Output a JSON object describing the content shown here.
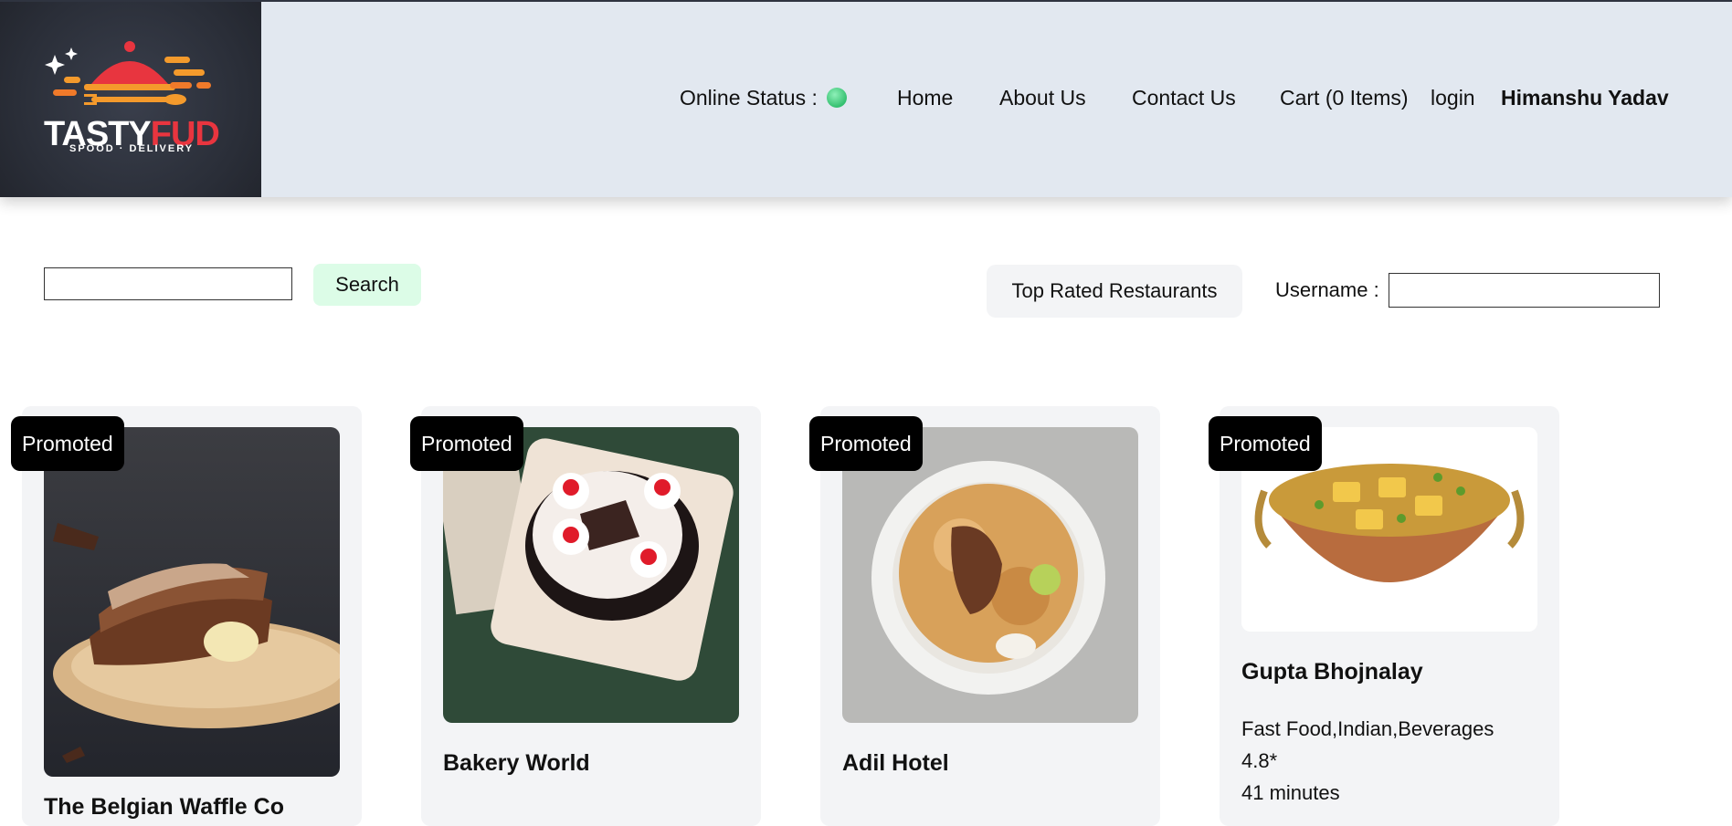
{
  "header": {
    "brand": {
      "name_part1": "TASTY",
      "name_part2": "FUD",
      "tagline": "SPOOD · DELIVERY"
    },
    "online_status_label": "Online Status :",
    "online_status_color": "#35c070",
    "nav": {
      "home": "Home",
      "about": "About Us",
      "contact": "Contact Us",
      "cart": "Cart (0 Items)",
      "login": "login"
    },
    "user_name": "Himanshu Yadav"
  },
  "search": {
    "value": "",
    "button_label": "Search"
  },
  "filters": {
    "top_rated_label": "Top Rated Restaurants"
  },
  "username": {
    "label": "Username :",
    "value": ""
  },
  "restaurants": [
    {
      "badge": "Promoted",
      "name": "The Belgian Waffle Co",
      "image": "waffle-sandwich-photo"
    },
    {
      "badge": "Promoted",
      "name": "Bakery World",
      "image": "black-forest-cake-photo"
    },
    {
      "badge": "Promoted",
      "name": "Adil Hotel",
      "image": "biryani-plate-photo"
    },
    {
      "badge": "Promoted",
      "name": "Gupta Bhojnalay",
      "cuisines": "Fast Food,Indian,Beverages",
      "rating": "4.8*",
      "eta": "41 minutes",
      "image": "paneer-curry-photo"
    }
  ],
  "colors": {
    "header_bg": "#e2e8f0",
    "search_btn_bg": "#dcfce7",
    "card_bg": "#f3f4f6",
    "badge_bg": "#000000"
  }
}
